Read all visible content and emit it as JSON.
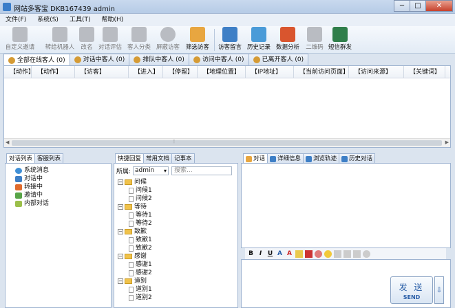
{
  "window": {
    "title": "网站多客宝  DKB167439  admin",
    "buttons": [
      "─",
      "□",
      "✕"
    ]
  },
  "menu": [
    "文件(F)",
    "系统(S)",
    "工具(T)",
    "帮助(H)"
  ],
  "toolbar": [
    {
      "label": "自定义邀请",
      "icon": "invite-icon",
      "active": false
    },
    {
      "label": "转给机器人",
      "icon": "robot-icon",
      "active": false
    },
    {
      "label": "改名",
      "icon": "rename-icon",
      "active": false
    },
    {
      "label": "对话评估",
      "icon": "evaluate-icon",
      "active": false
    },
    {
      "label": "客人分类",
      "icon": "classify-icon",
      "active": false
    },
    {
      "label": "屏蔽访客",
      "icon": "block-icon",
      "active": false
    },
    {
      "label": "筛选访客",
      "icon": "filter-icon",
      "active": true
    },
    {
      "label": "访客留言",
      "icon": "message-icon",
      "active": true
    },
    {
      "label": "历史记录",
      "icon": "history-icon",
      "active": true
    },
    {
      "label": "数据分析",
      "icon": "chart-icon",
      "active": true
    },
    {
      "label": "二维码",
      "icon": "qrcode-icon",
      "active": false
    },
    {
      "label": "短信群发",
      "icon": "sms-icon",
      "active": true
    }
  ],
  "visitor_tabs": [
    {
      "label": "全部在线客人 (0)",
      "active": true
    },
    {
      "label": "对话中客人 (0)",
      "active": false
    },
    {
      "label": "排队中客人 (0)",
      "active": false
    },
    {
      "label": "访问中客人 (0)",
      "active": false
    },
    {
      "label": "已离开客人 (0)",
      "active": false
    }
  ],
  "grid_columns": [
    "【动作】",
    "【动作】",
    "【访客】",
    "【进入】",
    "【停留】",
    "【地理位置】",
    "【IP地址】",
    "【当前访问页面】",
    "【访问来源】",
    "【关键词】"
  ],
  "left_panel": {
    "tabs": [
      "对话列表",
      "客服列表"
    ],
    "items": [
      {
        "label": "系统消息",
        "color": "#3f8fd6"
      },
      {
        "label": "对话中",
        "color": "#3e7fc6"
      },
      {
        "label": "转接中",
        "color": "#e06b2d"
      },
      {
        "label": "邀请中",
        "color": "#58a447"
      },
      {
        "label": "内部对话",
        "color": "#9bbf4a"
      }
    ]
  },
  "mid_panel": {
    "tabs": [
      "快捷回复",
      "常用文档",
      "记事本"
    ],
    "owner_label": "所属:",
    "owner_value": "admin",
    "search_placeholder": "搜索...",
    "groups": [
      {
        "name": "问候",
        "items": [
          "问候1",
          "问候2"
        ]
      },
      {
        "name": "等待",
        "items": [
          "等待1",
          "等待2"
        ]
      },
      {
        "name": "致歉",
        "items": [
          "致歉1",
          "致歉2"
        ]
      },
      {
        "name": "感谢",
        "items": [
          "感谢1",
          "感谢2"
        ]
      },
      {
        "name": "道别",
        "items": [
          "道别1",
          "道别2"
        ]
      }
    ]
  },
  "right_panel": {
    "tabs": [
      "对话",
      "详细信息",
      "浏览轨迹",
      "历史对话"
    ],
    "editor_buttons": [
      "B",
      "I",
      "U"
    ],
    "send_label": "发 送",
    "send_label_en": "SEND"
  }
}
